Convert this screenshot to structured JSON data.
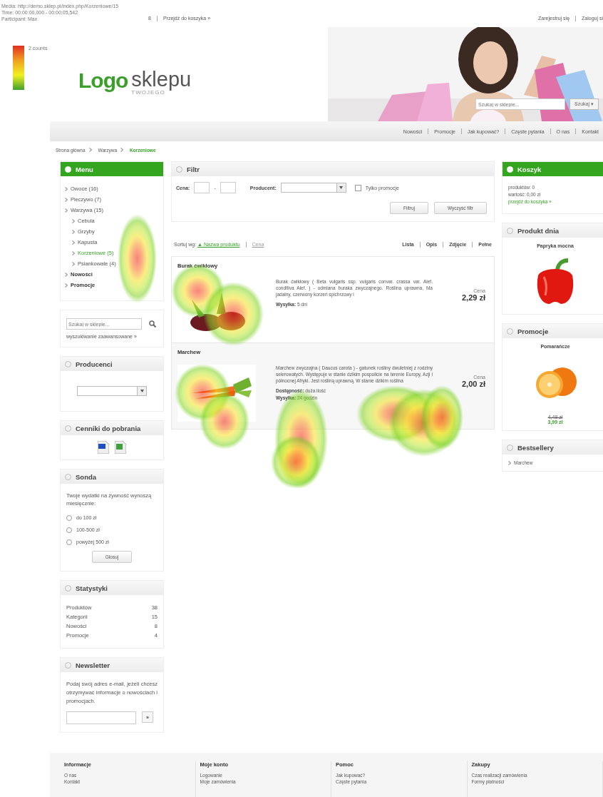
{
  "tracking": {
    "media": "Media: http://demo.sklep.pl/index.php/Korzeniowe/15",
    "time": "Time: 00:00:00,000 - 00:00:05,542",
    "participant": "Participant: Max",
    "legend_label": "2 counts"
  },
  "top_bar": {
    "cart_count": "8",
    "cart_link": "Przejdź do koszyka »",
    "account_links": [
      "Zarejestruj się",
      "Zaloguj si"
    ]
  },
  "logo": {
    "word": "Logo",
    "word2": "sklepu",
    "tagline": "TWOJEGO"
  },
  "header_search": {
    "placeholder": "Szukaj w sklepie...",
    "button": "Szukaj ▾"
  },
  "nav": [
    "Nowości",
    "Promocje",
    "Jak kupować?",
    "Częste pytania",
    "O nas",
    "Kontakt"
  ],
  "breadcrumb": [
    {
      "label": "Strona główna",
      "selected": false
    },
    {
      "label": "Warzywa",
      "selected": false
    },
    {
      "label": "Korzeniowe",
      "selected": true
    }
  ],
  "menu": {
    "title": "Menu",
    "items": [
      {
        "label": "Owoce (16)",
        "bold": false,
        "selected": false
      },
      {
        "label": "Pieczywo (7)",
        "bold": false,
        "selected": false
      },
      {
        "label": "Warzywa (15)",
        "bold": false,
        "selected": false,
        "children": [
          {
            "label": "Cebula",
            "selected": false
          },
          {
            "label": "Grzyby",
            "selected": false
          },
          {
            "label": "Kapusta",
            "selected": false
          },
          {
            "label": "Korzeniowe (5)",
            "selected": true
          },
          {
            "label": "Psiankowate (4)",
            "selected": false
          }
        ]
      },
      {
        "label": "Nowości",
        "bold": true,
        "selected": false
      },
      {
        "label": "Promocje",
        "bold": true,
        "selected": false
      }
    ]
  },
  "side_search": {
    "placeholder": "Szukaj w sklepie...",
    "link": "wyszukiwanie zaawansowane »"
  },
  "producers": {
    "title": "Producenci"
  },
  "price_lists": {
    "title": "Cenniki do pobrania"
  },
  "poll": {
    "title": "Sonda",
    "question": "Twoje wydatki na żywność wynoszą miesięcznie:",
    "options": [
      {
        "label": "do 100 zł",
        "selected": false
      },
      {
        "label": "100-500 zł",
        "selected": false
      },
      {
        "label": "powyżej 500 zł",
        "selected": false
      }
    ],
    "button": "Głosuj"
  },
  "stats": {
    "title": "Statystyki",
    "rows": [
      {
        "label": "Produktów",
        "value": "38"
      },
      {
        "label": "Kategorii",
        "value": "15"
      },
      {
        "label": "Nowości",
        "value": "8"
      },
      {
        "label": "Promocje",
        "value": "4"
      }
    ]
  },
  "newsletter": {
    "title": "Newsletter",
    "text": "Podaj swój adres e-mail, jeżeli chcesz otrzymywać informacje o nowościach i promocjach.",
    "button": "»"
  },
  "filter": {
    "title": "Filtr",
    "price_label": "Cena:",
    "dash": "-",
    "producer_label": "Producent:",
    "promo_label": "Tylko promocje",
    "promo_checked": false,
    "buttons": [
      "Filtruj",
      "Wyczyść filtr"
    ]
  },
  "sort": {
    "label": "Sortuj wg:",
    "options": [
      {
        "label": "▲ Nazwa produktu",
        "selected": true
      },
      {
        "label": "Cena",
        "selected": false
      }
    ],
    "views": [
      "Lista",
      "Opis",
      "Zdjęcie",
      "Pełne"
    ]
  },
  "products": [
    {
      "name": "Burak ćwikłowy",
      "description": "Burak ćwikłowy ( Beta vulgaris ssp. vulgaris convar. crassa var. Alef. conditiva Alef. ) - odmiana buraka zwyczajnego. Roślina uprawna, Ma jadalny, czerwony korzeń spichrzowy i",
      "details": [
        {
          "label": "Wysyłka:",
          "value": "5 dni"
        }
      ],
      "price_label": "Cena",
      "price": "2,29 zł"
    },
    {
      "name": "Marchew",
      "description": "Marchew zwyczajna ( Daucus carota ) - gatunek rośliny dwuletniej z rodziny selerowatych. Występuje w stanie dzikim pospolicie na terenie Europy, Azji i północnej Afryki. Jest rośliną uprawną. W stanie dzikim roślina",
      "details": [
        {
          "label": "Dostępność:",
          "value": "duża ilość"
        },
        {
          "label": "Wysyłka:",
          "value": "24 godzin"
        }
      ],
      "price_label": "Cena",
      "price": "2,00 zł"
    }
  ],
  "cart": {
    "title": "Koszyk",
    "lines": [
      "produktów: 0",
      "wartość: 0,00 zł"
    ],
    "link": "przejdź do koszyka »"
  },
  "product_of_day": {
    "title": "Produkt dnia",
    "name": "Papryka mocna"
  },
  "promotions": {
    "title": "Promocje",
    "name": "Pomarańcze",
    "old_price": "4,49 zł",
    "new_price": "3,99 zł"
  },
  "bestsellers": {
    "title": "Bestsellery",
    "items": [
      "Marchew"
    ]
  },
  "footer": [
    {
      "title": "Informacje",
      "links": [
        "O nas",
        "Kontakt"
      ]
    },
    {
      "title": "Moje konto",
      "links": [
        "Logowanie",
        "Moje zamówienia"
      ]
    },
    {
      "title": "Pomoc",
      "links": [
        "Jak kupować?",
        "Częste pytania"
      ]
    },
    {
      "title": "Zakupy",
      "links": [
        "Czas realizacji zamówienia",
        "Formy płatności"
      ]
    }
  ]
}
